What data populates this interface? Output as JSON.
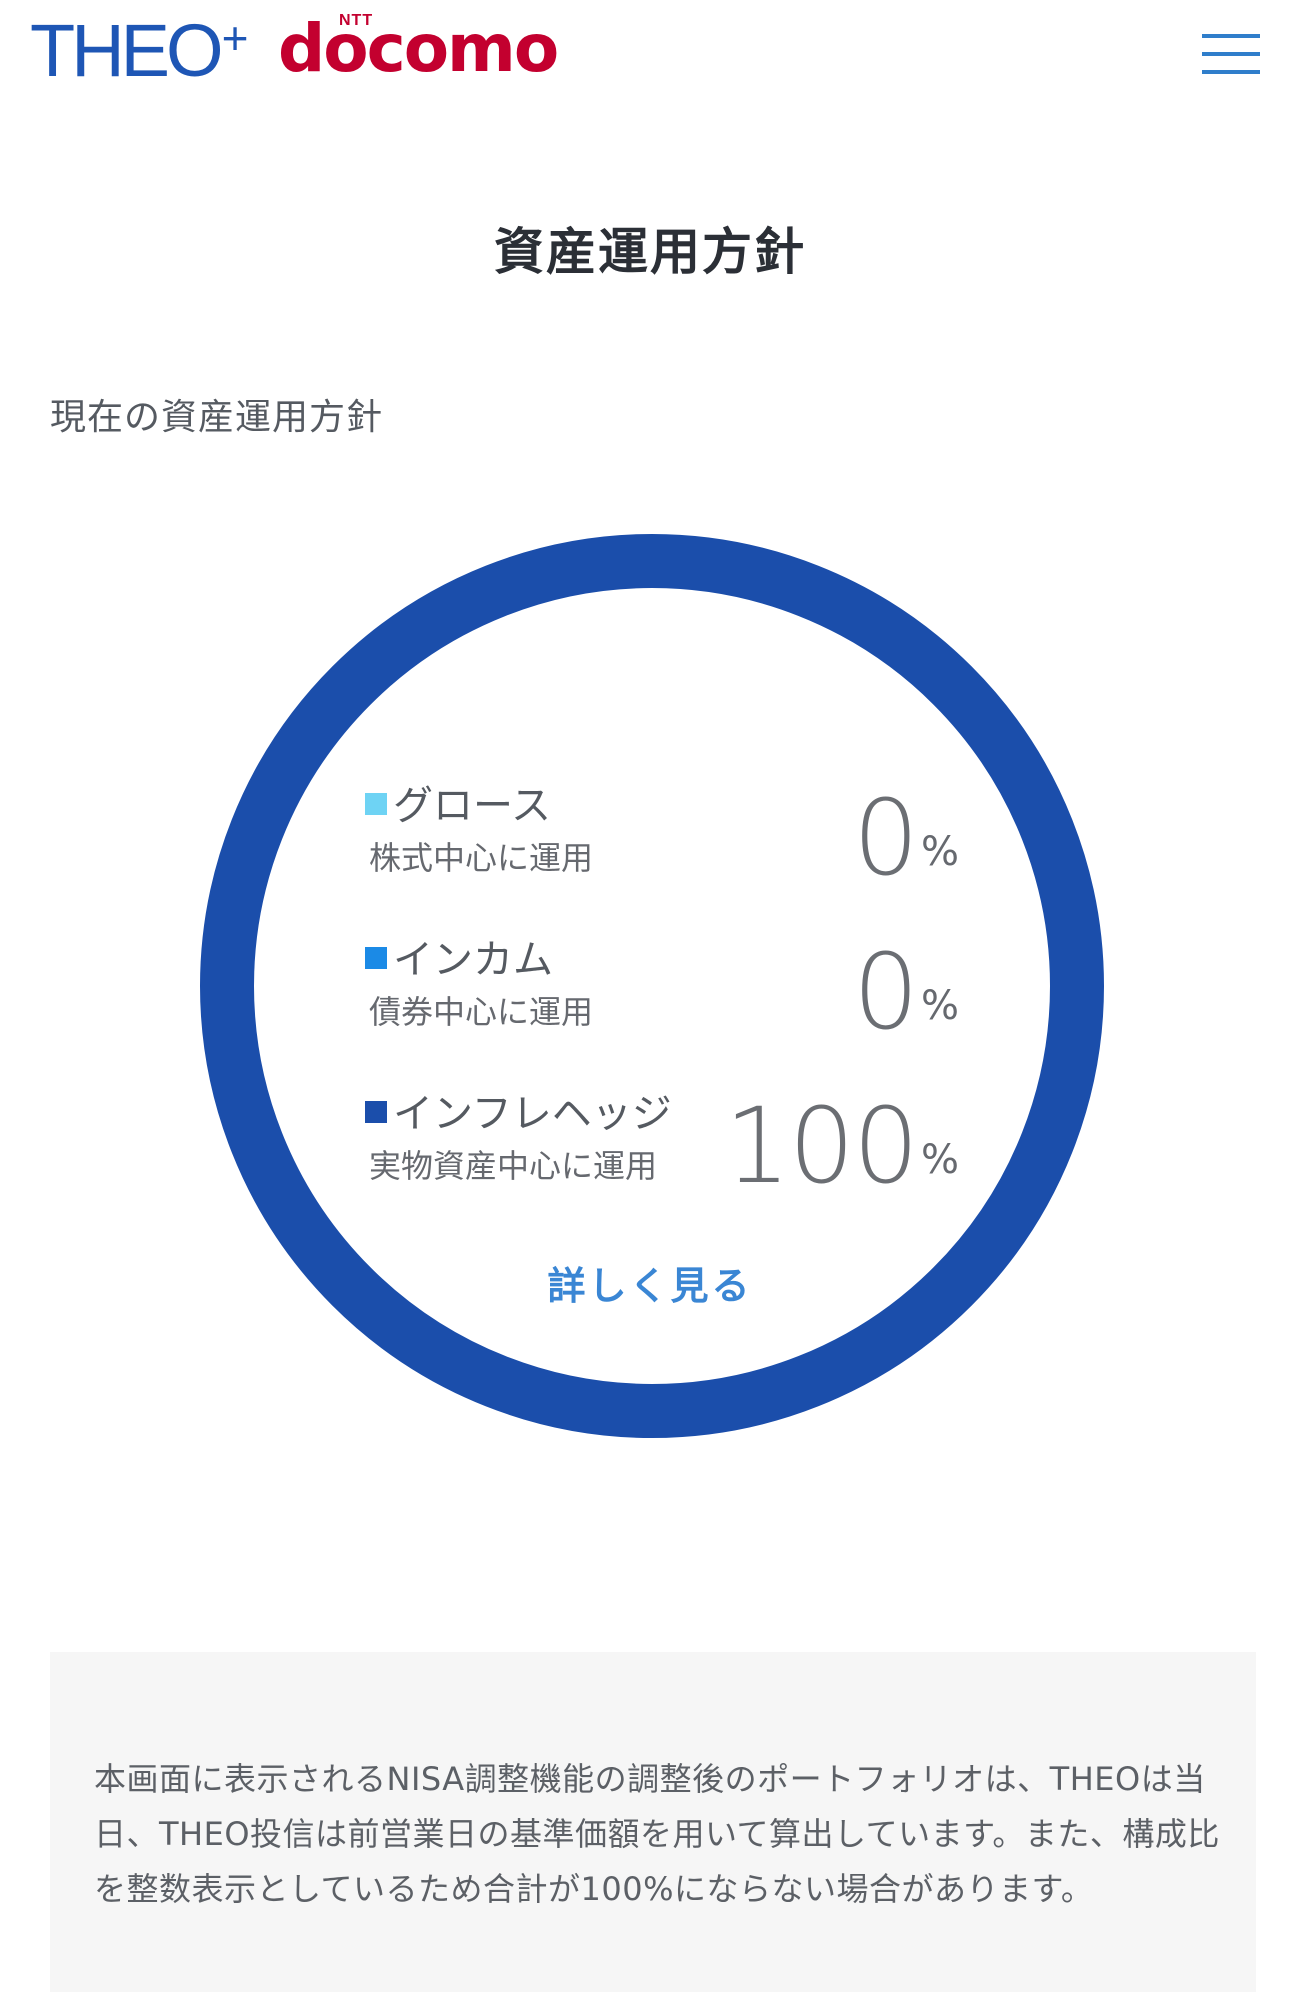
{
  "header": {
    "brand_theo": "THEO",
    "brand_plus": "+",
    "brand_ntt": "NTT",
    "brand_docomo": "docomo",
    "menu_icon": "hamburger-menu-icon"
  },
  "page": {
    "title": "資産運用方針",
    "section_label": "現在の資産運用方針"
  },
  "colors": {
    "ring": "#1b4eab",
    "growth": "#6ed3f4",
    "income": "#1b8ae6",
    "inflation_hedge": "#1b4eab",
    "link": "#3a86d4"
  },
  "allocations": [
    {
      "name": "グロース",
      "description": "株式中心に運用",
      "value": "0",
      "unit": "%"
    },
    {
      "name": "インカム",
      "description": "債券中心に運用",
      "value": "0",
      "unit": "%"
    },
    {
      "name": "インフレヘッジ",
      "description": "実物資産中心に運用",
      "value": "100",
      "unit": "%"
    }
  ],
  "details_link": "詳しく見る",
  "notice": "本画面に表示されるNISA調整機能の調整後のポートフォリオは、THEOは当日、THEO投信は前営業日の基準価額を用いて算出しています。また、構成比を整数表示としているため合計が100%にならない場合があります。"
}
